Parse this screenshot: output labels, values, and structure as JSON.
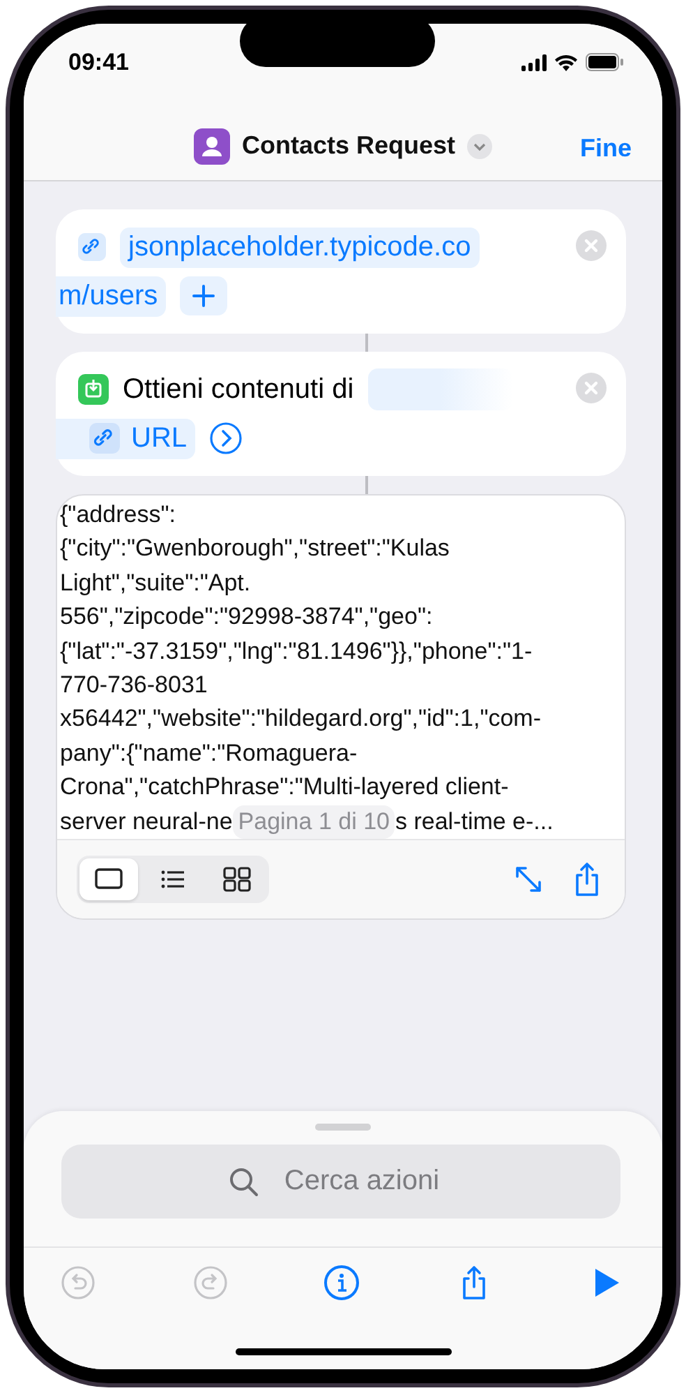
{
  "status_bar": {
    "time": "09:41"
  },
  "nav": {
    "title": "Contacts Request",
    "done": "Fine"
  },
  "actions": [
    {
      "kind": "url",
      "parts": [
        "jsonplaceholder.typicode.co",
        "m/users"
      ]
    },
    {
      "kind": "get",
      "label": "Ottieni contenuti di",
      "variable": "URL"
    }
  ],
  "output": {
    "text": "{\"address\":\n{\"city\":\"Gwenborough\",\"street\":\"Kulas\nLight\",\"suite\":\"Apt.\n556\",\"zipcode\":\"92998-3874\",\"geo\":\n{\"lat\":\"-37.3159\",\"lng\":\"81.1496\"}},\"phone\":\"1-\n770-736-8031\nx56442\",\"website\":\"hildegard.org\",\"id\":1,\"com-\npany\":{\"name\":\"Romaguera-\nCrona\",\"catchPhrase\":\"Multi-layered client-",
    "last_line_start": "server neural-ne",
    "page_label": "Pagina 1 di 10",
    "last_line_end": "s real-time e-...",
    "view_modes": [
      {
        "kind": "single",
        "selected": true
      },
      {
        "kind": "list",
        "selected": false
      },
      {
        "kind": "grid",
        "selected": false
      }
    ]
  },
  "search": {
    "placeholder": "Cerca azioni"
  },
  "toolbar": [
    {
      "kind": "undo",
      "disabled": true
    },
    {
      "kind": "redo",
      "disabled": true
    },
    {
      "kind": "info",
      "disabled": false
    },
    {
      "kind": "share",
      "disabled": false
    },
    {
      "kind": "run",
      "disabled": false
    }
  ]
}
